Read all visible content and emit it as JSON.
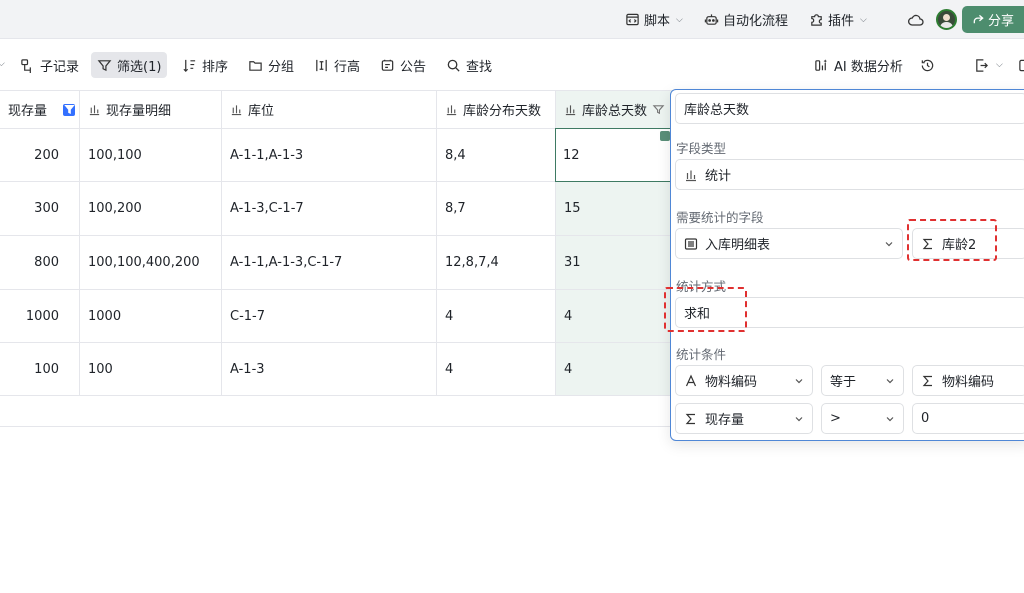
{
  "topbar": {
    "script_label": "脚本",
    "automation_label": "自动化流程",
    "plugin_label": "插件",
    "share_label": "分享"
  },
  "toolbar": {
    "subrecord": "子记录",
    "filter": "筛选(1)",
    "sort": "排序",
    "group": "分组",
    "row_height": "行高",
    "notice": "公告",
    "find": "查找",
    "ai_analysis": "AI 数据分析"
  },
  "table": {
    "columns": [
      "现存量",
      "现存量明细",
      "库位",
      "库龄分布天数",
      "库龄总天数"
    ],
    "rows": [
      [
        "200",
        "100,100",
        "A-1-1,A-1-3",
        "8,4",
        "12"
      ],
      [
        "300",
        "100,200",
        "A-1-3,C-1-7",
        "8,7",
        "15"
      ],
      [
        "800",
        "100,100,400,200",
        "A-1-1,A-1-3,C-1-7",
        "12,8,7,4",
        "31"
      ],
      [
        "1000",
        "1000",
        "C-1-7",
        "4",
        "4"
      ],
      [
        "100",
        "100",
        "A-1-3",
        "4",
        "4"
      ]
    ]
  },
  "panel": {
    "field_name": "库龄总天数",
    "field_type_label": "字段类型",
    "field_type_value": "统计",
    "stat_field_label": "需要统计的字段",
    "stat_table": "入库明细表",
    "stat_field": "库龄2",
    "method_label": "统计方式",
    "method_value": "求和",
    "condition_label": "统计条件",
    "conditions": [
      {
        "field": "物料编码",
        "op": "等于",
        "value": "物料编码"
      },
      {
        "field": "现存量",
        "op": ">",
        "value": "0"
      }
    ]
  },
  "colors": {
    "accent": "#4d8d6e",
    "highlight_column": "#edf4f1",
    "annotation": "#e03030",
    "panel_border": "#4f87d6"
  }
}
